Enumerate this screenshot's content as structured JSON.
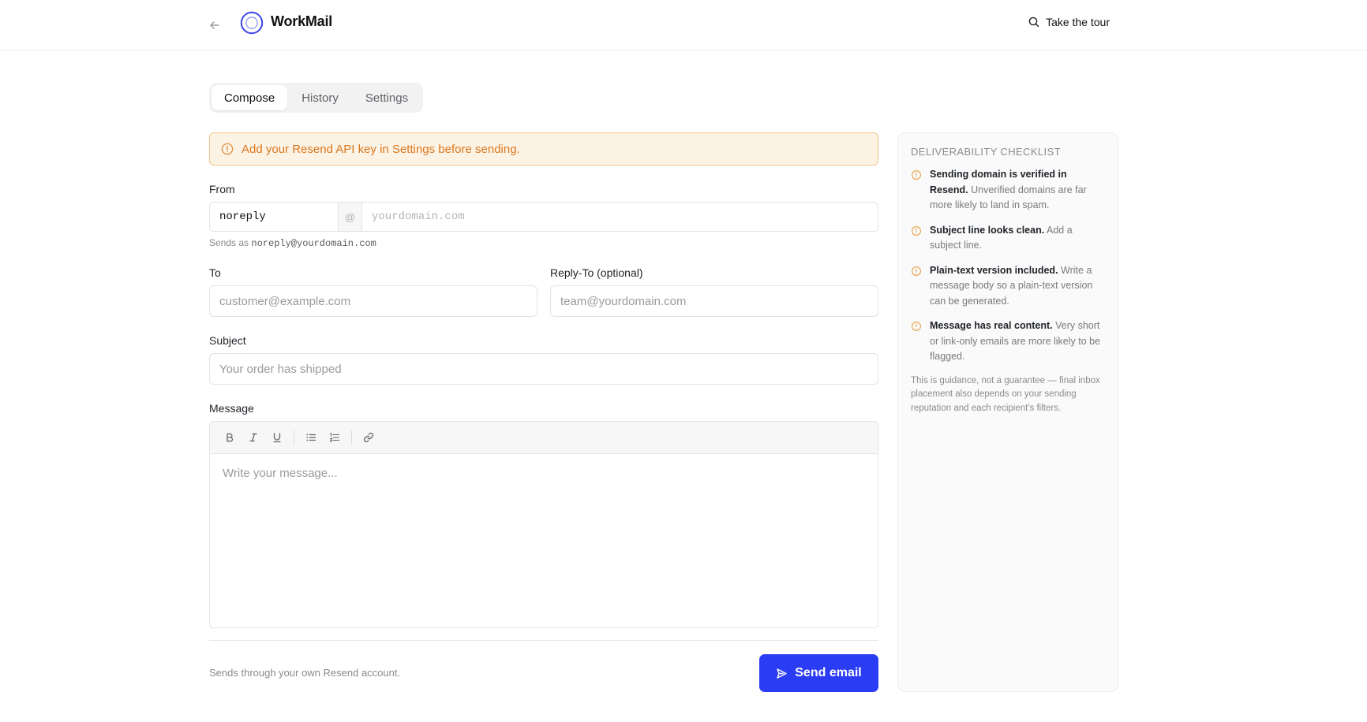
{
  "header": {
    "brand": "WorkMail",
    "tour_label": "Take the tour"
  },
  "tabs": [
    {
      "label": "Compose",
      "active": true
    },
    {
      "label": "History",
      "active": false
    },
    {
      "label": "Settings",
      "active": false
    }
  ],
  "alert": {
    "text": "Add your Resend API key in Settings before sending."
  },
  "form": {
    "from_label": "From",
    "from_local_value": "noreply",
    "from_at": "@",
    "from_domain_placeholder": "yourdomain.com",
    "sends_as_prefix": "Sends as",
    "sends_as_address": "noreply@yourdomain.com",
    "to_label": "To",
    "to_placeholder": "customer@example.com",
    "reply_to_label": "Reply-To (optional)",
    "reply_to_placeholder": "team@yourdomain.com",
    "subject_label": "Subject",
    "subject_placeholder": "Your order has shipped",
    "message_label": "Message",
    "message_placeholder": "Write your message...",
    "toolbar": [
      "bold-icon",
      "italic-icon",
      "underline-icon",
      "bullet-list-icon",
      "numbered-list-icon",
      "link-icon"
    ]
  },
  "footer": {
    "note": "Sends through your own Resend account.",
    "send_label": "Send email"
  },
  "checklist": {
    "title": "DELIVERABILITY CHECKLIST",
    "items": [
      {
        "title": "Sending domain is verified in Resend.",
        "detail": "Unverified domains are far more likely to land in spam."
      },
      {
        "title": "Subject line looks clean.",
        "detail": "Add a subject line."
      },
      {
        "title": "Plain-text version included.",
        "detail": "Write a message body so a plain-text version can be generated."
      },
      {
        "title": "Message has real content.",
        "detail": "Very short or link-only emails are more likely to be flagged."
      }
    ],
    "note": "This is guidance, not a guarantee — final inbox placement also depends on your sending reputation and each recipient's filters."
  },
  "colors": {
    "accent": "#2b3cf5",
    "warning": "#d9771f",
    "warning_bg": "#fdf3e4",
    "checklist_icon": "#e9a04f"
  }
}
